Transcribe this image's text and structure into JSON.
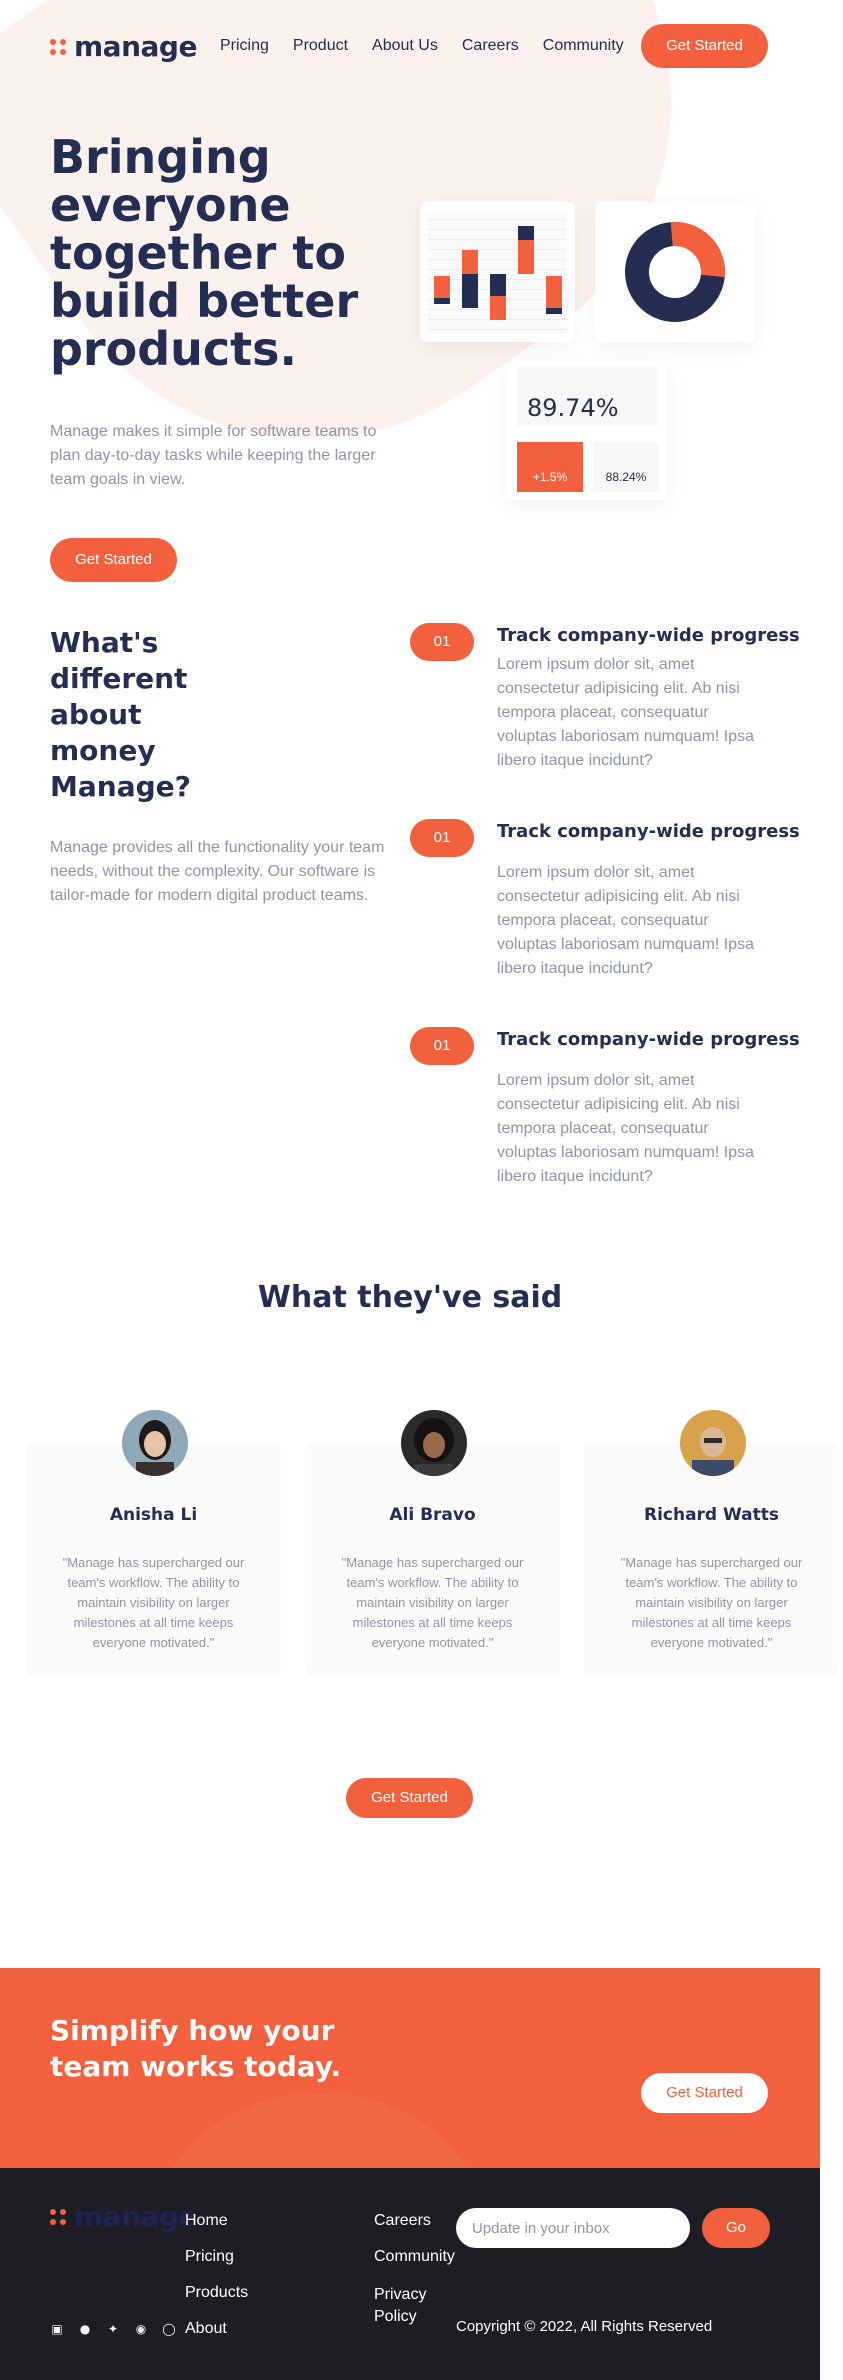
{
  "header": {
    "logo": "manage",
    "nav": [
      "Pricing",
      "Product",
      "About Us",
      "Careers",
      "Community"
    ],
    "cta": "Get Started"
  },
  "hero": {
    "title": "Bringing everyone together to build better products.",
    "description": "Manage makes it simple for software teams to plan day-to-day tasks while keeping the larger team goals in view.",
    "cta": "Get Started",
    "dashboard": {
      "main_stat": "89.74%",
      "change_stat": "+1.5%",
      "secondary_stat": "88.24%",
      "donut_orange_fraction": 0.28
    }
  },
  "features": {
    "title": "What's different about money Manage?",
    "description": "Manage provides all the functionality your team needs, without the complexity. Our software is tailor-made for modern digital product teams.",
    "items": [
      {
        "num": "01",
        "title": "Track company-wide progress",
        "text": "Lorem ipsum dolor sit, amet consectetur adipisicing elit. Ab nisi tempora placeat, consequatur voluptas laboriosam numquam! Ipsa libero itaque incidunt?"
      },
      {
        "num": "01",
        "title": "Track company-wide progress",
        "text": "Lorem ipsum dolor sit, amet consectetur adipisicing elit. Ab nisi tempora placeat, consequatur voluptas laboriosam numquam! Ipsa libero itaque incidunt?"
      },
      {
        "num": "01",
        "title": "Track company-wide progress",
        "text": "Lorem ipsum dolor sit, amet consectetur adipisicing elit. Ab nisi tempora placeat, consequatur voluptas laboriosam numquam! Ipsa libero itaque incidunt?"
      }
    ]
  },
  "testimonials": {
    "heading": "What they've said",
    "items": [
      {
        "name": "Anisha Li",
        "quote": "\"Manage has supercharged our team's workflow. The ability to maintain visibility on larger milestones at all time keeps everyone motivated.\""
      },
      {
        "name": "Ali Bravo",
        "quote": "\"Manage has supercharged our team's workflow. The ability to maintain visibility on larger milestones at all time keeps everyone motivated.\""
      },
      {
        "name": "Richard Watts",
        "quote": "\"Manage has supercharged our team's workflow. The ability to maintain visibility on larger milestones at all time keeps everyone motivated.\""
      }
    ],
    "cta": "Get Started"
  },
  "cta_banner": {
    "title": "Simplify how your team works today.",
    "cta": "Get Started"
  },
  "footer": {
    "logo": "manage",
    "col1": [
      "Home",
      "Pricing",
      "Products",
      "About"
    ],
    "col2": [
      "Careers",
      "Community",
      "Privacy Policy"
    ],
    "input_placeholder": "Update in your inbox",
    "go": "Go",
    "copyright": "Copyright © 2022, All Rights Reserved",
    "socials": [
      "facebook-icon",
      "youtube-icon",
      "twitter-icon",
      "pinterest-icon",
      "instagram-icon"
    ]
  },
  "colors": {
    "accent": "#f2603d",
    "navy": "#242d52",
    "muted": "#9095a7",
    "footer_bg": "#1d1d26"
  }
}
